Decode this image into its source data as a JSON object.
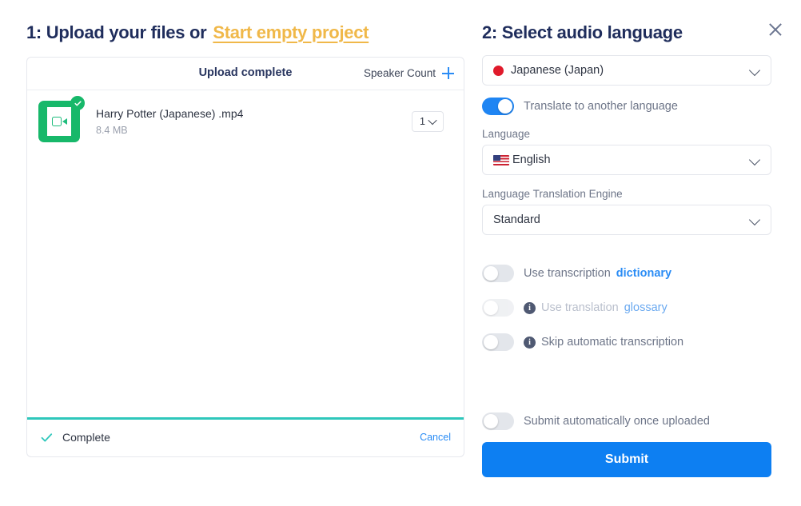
{
  "left": {
    "step_title": "1: Upload your files or",
    "start_empty_link": "Start empty project",
    "card": {
      "head_title": "Upload complete",
      "speaker_count_label": "Speaker Count",
      "file": {
        "name": "Harry Potter (Japanese) .mp4",
        "size": "8.4 MB",
        "speaker_value": "1"
      },
      "footer": {
        "status": "Complete",
        "cancel": "Cancel"
      }
    }
  },
  "right": {
    "step_title": "2: Select audio language",
    "audio_language": {
      "value": "Japanese (Japan)",
      "flag": "jp-flag-icon"
    },
    "translate_toggle": {
      "label": "Translate to another language",
      "state": "on"
    },
    "language": {
      "label": "Language",
      "value": "English",
      "flag": "us-flag-icon"
    },
    "translation_engine": {
      "label": "Language Translation Engine",
      "value": "Standard"
    },
    "options": [
      {
        "id": "use-transcription-dictionary",
        "text": "Use transcription",
        "link": "dictionary",
        "state": "off",
        "disabled": false,
        "info": false
      },
      {
        "id": "use-translation-glossary",
        "text": "Use translation",
        "link": "glossary",
        "state": "off",
        "disabled": true,
        "info": true
      },
      {
        "id": "skip-automatic-transcription",
        "text": "Skip automatic transcription",
        "link": "",
        "state": "off",
        "disabled": false,
        "info": true
      }
    ],
    "auto_submit": {
      "label": "Submit automatically once uploaded",
      "state": "off"
    },
    "submit_label": "Submit"
  },
  "colors": {
    "accent_blue": "#0d7ff2",
    "link_blue": "#2a8cf5",
    "title_navy": "#1f2d5c",
    "gold": "#f0b849",
    "green": "#17b86a",
    "teal": "#2ec7bb"
  }
}
